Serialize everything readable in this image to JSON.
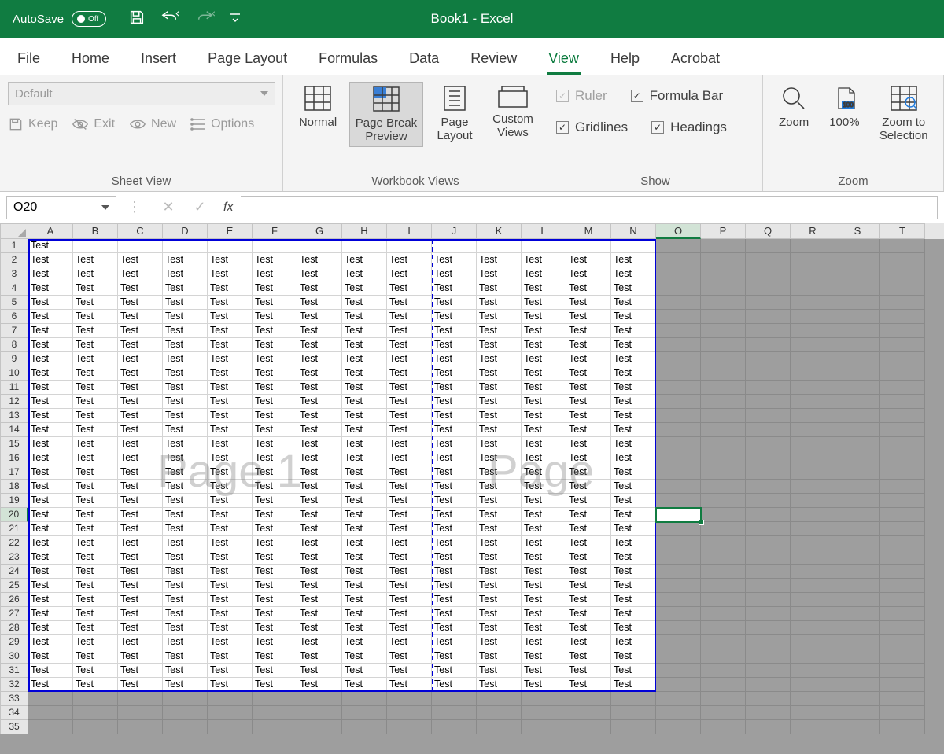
{
  "titlebar": {
    "autosave_label": "AutoSave",
    "autosave_state": "Off",
    "title_doc": "Book1",
    "title_sep": "-",
    "title_app": "Excel"
  },
  "tabs": {
    "file": "File",
    "home": "Home",
    "insert": "Insert",
    "page_layout": "Page Layout",
    "formulas": "Formulas",
    "data": "Data",
    "review": "Review",
    "view": "View",
    "help": "Help",
    "acrobat": "Acrobat"
  },
  "ribbon": {
    "sheet_view": {
      "select_value": "Default",
      "keep": "Keep",
      "exit": "Exit",
      "new_": "New",
      "options": "Options",
      "group_label": "Sheet View"
    },
    "workbook_views": {
      "normal": "Normal",
      "page_break": "Page Break Preview",
      "page_layout": "Page Layout",
      "custom_views": "Custom Views",
      "group_label": "Workbook Views"
    },
    "show": {
      "ruler": "Ruler",
      "formula_bar": "Formula Bar",
      "gridlines": "Gridlines",
      "headings": "Headings",
      "group_label": "Show"
    },
    "zoom": {
      "zoom": "Zoom",
      "hundred": "100%",
      "to_selection": "Zoom to Selection",
      "group_label": "Zoom"
    }
  },
  "formula_bar": {
    "name_box_value": "O20",
    "fx_label": "fx"
  },
  "grid": {
    "columns": [
      "A",
      "B",
      "C",
      "D",
      "E",
      "F",
      "G",
      "H",
      "I",
      "J",
      "K",
      "L",
      "M",
      "N",
      "O",
      "P",
      "Q",
      "R",
      "S",
      "T"
    ],
    "rows": [
      1,
      2,
      3,
      4,
      5,
      6,
      7,
      8,
      9,
      10,
      11,
      12,
      13,
      14,
      15,
      16,
      17,
      18,
      19,
      20,
      21,
      22,
      23,
      24,
      25,
      26,
      27,
      28,
      29,
      30,
      31,
      32,
      33,
      34,
      35
    ],
    "cell_value": "Test",
    "selected_col": "O",
    "selected_row": 20,
    "watermark1": "Page 1",
    "watermark2": "Page"
  }
}
